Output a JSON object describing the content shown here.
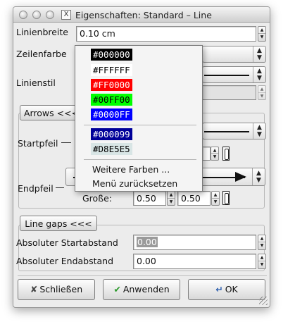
{
  "window": {
    "title": "Eigenschaften: Standard – Line",
    "app_icon": "X"
  },
  "fields": {
    "line_width_label": "Linienbreite",
    "line_width_value": "0.10 cm",
    "line_color_label": "Zeilenfarbe",
    "line_style_label": "Linienstil"
  },
  "arrows": {
    "toggle_label": "Arrows <<<",
    "start_label": "Startpfeil",
    "end_label": "Endpfeil",
    "size_label": "Große:",
    "size_w": "0.50",
    "size_h": "0.50"
  },
  "gaps": {
    "toggle_label": "Line gaps <<<",
    "start_label": "Absoluter Startabstand",
    "start_value": "0.00",
    "end_label": "Absoluter Endabstand",
    "end_value": "0.00"
  },
  "buttons": {
    "close": "Schließen",
    "apply": "Anwenden",
    "ok": "OK"
  },
  "color_menu": {
    "swatches": [
      {
        "label": "#000000",
        "bg": "#000000",
        "fg": "#ffffff"
      },
      {
        "label": "#FFFFFF",
        "bg": "#ffffff",
        "fg": "#000000"
      },
      {
        "label": "#FF0000",
        "bg": "#ff0000",
        "fg": "#ffffff"
      },
      {
        "label": "#00FF00",
        "bg": "#00ff00",
        "fg": "#000000"
      },
      {
        "label": "#0000FF",
        "bg": "#0000ff",
        "fg": "#ffffff"
      },
      {
        "label": "#000099",
        "bg": "#000099",
        "fg": "#ffffff"
      },
      {
        "label": "#D8E5E5",
        "bg": "#d8e5e5",
        "fg": "#000000"
      }
    ],
    "more_colors": "Weitere Farben ...",
    "reset_menu": "Menü zurücksetzen"
  }
}
